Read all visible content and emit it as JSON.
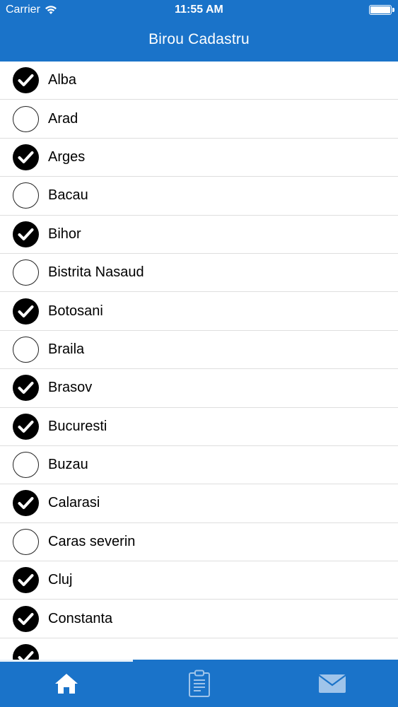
{
  "status_bar": {
    "carrier": "Carrier",
    "time": "11:55 AM"
  },
  "nav": {
    "title": "Birou Cadastru"
  },
  "list": {
    "items": [
      {
        "label": "Alba",
        "checked": true
      },
      {
        "label": "Arad",
        "checked": false
      },
      {
        "label": "Arges",
        "checked": true
      },
      {
        "label": "Bacau",
        "checked": false
      },
      {
        "label": "Bihor",
        "checked": true
      },
      {
        "label": "Bistrita Nasaud",
        "checked": false
      },
      {
        "label": "Botosani",
        "checked": true
      },
      {
        "label": "Braila",
        "checked": false
      },
      {
        "label": "Brasov",
        "checked": true
      },
      {
        "label": "Bucuresti",
        "checked": true
      },
      {
        "label": "Buzau",
        "checked": false
      },
      {
        "label": "Calarasi",
        "checked": true
      },
      {
        "label": "Caras severin",
        "checked": false
      },
      {
        "label": "Cluj",
        "checked": true
      },
      {
        "label": "Constanta",
        "checked": true
      },
      {
        "label": "",
        "checked": true
      }
    ]
  },
  "tabbar": {
    "selected": "home",
    "tabs": [
      {
        "id": "home",
        "icon": "home-icon"
      },
      {
        "id": "clipboard",
        "icon": "clipboard-icon"
      },
      {
        "id": "mail",
        "icon": "mail-icon"
      }
    ]
  },
  "colors": {
    "brand": "#1a73c9",
    "checked": "#000000",
    "separator": "#dedede"
  }
}
